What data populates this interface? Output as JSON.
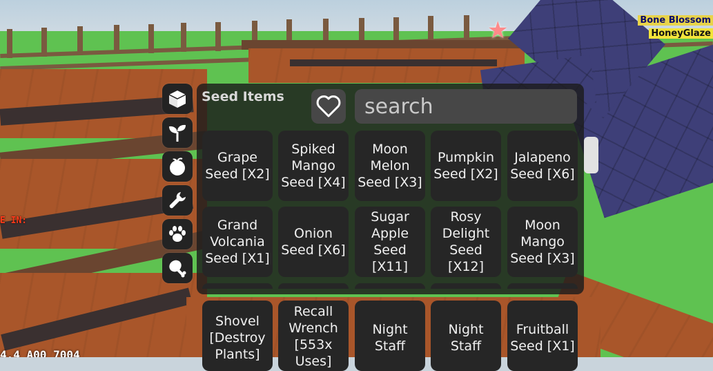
{
  "panel": {
    "title": "Seed Items",
    "search_placeholder": "search"
  },
  "categories": [
    {
      "name": "box-icon",
      "active": true
    },
    {
      "name": "sprout-icon"
    },
    {
      "name": "fruit-icon"
    },
    {
      "name": "wrench-icon"
    },
    {
      "name": "paw-icon"
    },
    {
      "name": "drumstick-icon"
    }
  ],
  "items_row1": [
    "Grape\nSeed [X2]",
    "Spiked\nMango\nSeed [X4]",
    "Moon\nMelon\nSeed [X3]",
    "Pumpkin\nSeed [X2]",
    "Jalapeno\nSeed [X6]"
  ],
  "items_row2": [
    "Grand\nVolcania\nSeed [X1]",
    "Onion\nSeed [X6]",
    "Sugar\nApple\nSeed\n[X11]",
    "Rosy\nDelight\nSeed\n[X12]",
    "Moon\nMango\nSeed [X3]"
  ],
  "items_row3": [
    "Shovel\n[Destroy\nPlants]",
    "Recall\nWrench\n[553x\nUses]",
    "Night\nStaff",
    "Night\nStaff",
    "Fruitball\nSeed [X1]"
  ],
  "hud": {
    "left_label": "E IN:",
    "bottom_counter": "4.4  A00  7004",
    "name_top": "Bone Blossom",
    "name_bottom": "HoneyGlaze"
  },
  "colors": {
    "panel_bg": "#1c1c1c",
    "tile_bg": "#262626",
    "search_bg": "#474747",
    "grass": "#5fc251",
    "soil": "#a9562a"
  }
}
